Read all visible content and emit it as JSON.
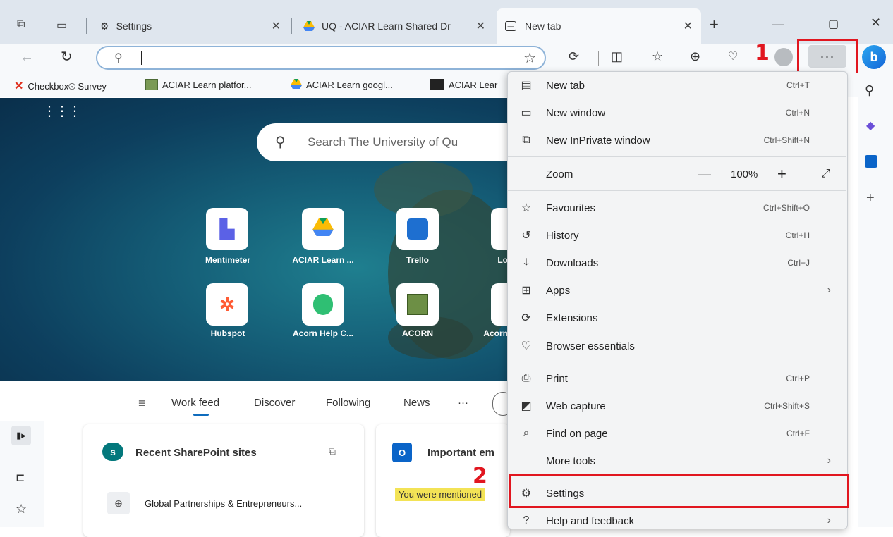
{
  "tabs": [
    {
      "title": "Settings",
      "icon": "gear-icon"
    },
    {
      "title": "UQ - ACIAR Learn Shared Dr",
      "icon": "google-drive-icon"
    },
    {
      "title": "New tab",
      "icon": "new-tab-icon",
      "active": true
    }
  ],
  "omnibox": {
    "value": "",
    "placeholder": ""
  },
  "favourites": [
    {
      "label": "Checkbox® Survey"
    },
    {
      "label": "ACIAR Learn platfor..."
    },
    {
      "label": "ACIAR Learn googl..."
    },
    {
      "label": "ACIAR Lear"
    }
  ],
  "newtab": {
    "search_placeholder": "Search The University of Qu",
    "tiles": [
      {
        "label": "Mentimeter"
      },
      {
        "label": "ACIAR Learn ..."
      },
      {
        "label": "Trello"
      },
      {
        "label": "Lo"
      },
      {
        "label": "Hubspot"
      },
      {
        "label": "Acorn Help C..."
      },
      {
        "label": "ACORN"
      },
      {
        "label": "Acorn"
      }
    ],
    "feed_nav": [
      "Work feed",
      "Discover",
      "Following",
      "News",
      "···"
    ],
    "cards": {
      "sharepoint_title": "Recent SharePoint sites",
      "sharepoint_item": "Global Partnerships & Entrepreneurs...",
      "email_title": "Important em",
      "mention_badge": "You were mentioned"
    }
  },
  "menu": {
    "items": [
      {
        "label": "New tab",
        "shortcut": "Ctrl+T",
        "icon": "new-tab-icon"
      },
      {
        "label": "New window",
        "shortcut": "Ctrl+N",
        "icon": "window-icon"
      },
      {
        "label": "New InPrivate window",
        "shortcut": "Ctrl+Shift+N",
        "icon": "inprivate-icon"
      },
      {
        "label": "Favourites",
        "shortcut": "Ctrl+Shift+O",
        "icon": "favourites-icon"
      },
      {
        "label": "History",
        "shortcut": "Ctrl+H",
        "icon": "history-icon"
      },
      {
        "label": "Downloads",
        "shortcut": "Ctrl+J",
        "icon": "download-icon"
      },
      {
        "label": "Apps",
        "shortcut": "",
        "icon": "apps-icon"
      },
      {
        "label": "Extensions",
        "shortcut": "",
        "icon": "extensions-icon"
      },
      {
        "label": "Browser essentials",
        "shortcut": "",
        "icon": "heart-pulse-icon"
      },
      {
        "label": "Print",
        "shortcut": "Ctrl+P",
        "icon": "print-icon"
      },
      {
        "label": "Web capture",
        "shortcut": "Ctrl+Shift+S",
        "icon": "web-capture-icon"
      },
      {
        "label": "Find on page",
        "shortcut": "Ctrl+F",
        "icon": "find-icon"
      },
      {
        "label": "More tools",
        "shortcut": "",
        "icon": ""
      },
      {
        "label": "Settings",
        "shortcut": "",
        "icon": "gear-icon"
      },
      {
        "label": "Help and feedback",
        "shortcut": "",
        "icon": "help-icon"
      }
    ],
    "zoom": {
      "label": "Zoom",
      "value": "100%"
    }
  },
  "annotations": {
    "step1": "1",
    "step2": "2",
    "highlight_color": "#e1161f"
  }
}
